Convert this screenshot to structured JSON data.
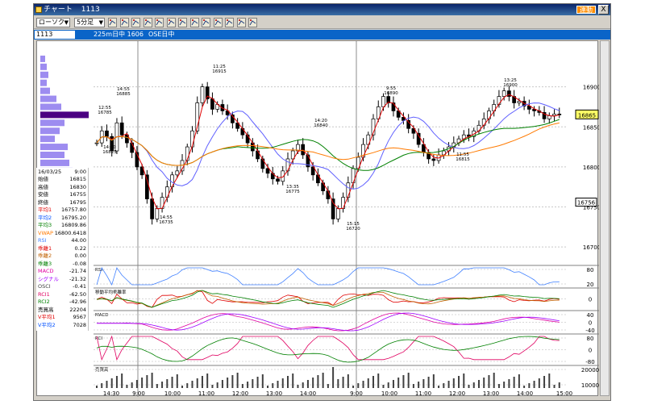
{
  "window": {
    "title": "チャート",
    "symbol": "1113",
    "link_label": "連動",
    "close_label": "X"
  },
  "toolbar": {
    "chart_type": "ローソク",
    "interval": "5分足",
    "tools": [
      "line-tool",
      "trend-tool",
      "hline-tool",
      "vline-tool",
      "fib-tool",
      "zoom-tool",
      "bar-tool",
      "print-tool",
      "draw-tool",
      "copy-tool",
      "paste-tool",
      "settings-tool",
      "delete-tool"
    ]
  },
  "infobar": {
    "symbol": "1113",
    "session": "225m日中 1606",
    "exchange": "OSE日中"
  },
  "price_axis": {
    "ticks": [
      "16900",
      "16850",
      "16800",
      "16750",
      "16700"
    ],
    "last_price": "16865",
    "marker_price": "16756"
  },
  "indicator_axes": {
    "rsi": [
      "80",
      "20"
    ],
    "dev": [
      "0"
    ],
    "macd": [
      "40",
      "0",
      "-40"
    ],
    "rci": [
      "80",
      "0",
      "-80"
    ],
    "volume": [
      "20000",
      "10000"
    ]
  },
  "time_axis": [
    "14:30",
    "9:00",
    "10:00",
    "11:00",
    "12:00",
    "13:00",
    "14:00",
    "9:00",
    "10:00",
    "11:00",
    "12:00",
    "13:00",
    "14:00",
    "15:00"
  ],
  "annotations": [
    {
      "time": "14:55",
      "price": "16885"
    },
    {
      "time": "11:25",
      "price": "16915"
    },
    {
      "time": "14:30",
      "price": "16825"
    },
    {
      "time": "12:55",
      "price": "16785"
    },
    {
      "time": "14:55",
      "price": "16735"
    },
    {
      "time": "14:20",
      "price": "16840"
    },
    {
      "time": "13:35",
      "price": "16775"
    },
    {
      "time": "15:15",
      "price": "16720"
    },
    {
      "time": "9:55",
      "price": "16890"
    },
    {
      "time": "13:25",
      "price": "16900"
    },
    {
      "time": "11:55",
      "price": "16815"
    }
  ],
  "panel_labels": {
    "rsi": "RSI",
    "dev": "移動平均乖離率",
    "macd": "MACD",
    "rci": "RCI",
    "volume": "売買高"
  },
  "info_panel": {
    "date": "16/03/25",
    "time": "9:00",
    "rows": [
      {
        "label": "始値",
        "value": "16815",
        "color": "#000000"
      },
      {
        "label": "高値",
        "value": "16830",
        "color": "#000000"
      },
      {
        "label": "安値",
        "value": "16755",
        "color": "#000000"
      },
      {
        "label": "終値",
        "value": "16795",
        "color": "#000000"
      },
      {
        "label": "平均1",
        "value": "16757.80",
        "color": "#e00000"
      },
      {
        "label": "平均2",
        "value": "16795.20",
        "color": "#0050ff"
      },
      {
        "label": "平均3",
        "value": "16809.86",
        "color": "#008000"
      },
      {
        "label": "VWAP",
        "value": "16800.6418",
        "color": "#ff7a00"
      },
      {
        "label": "RSI",
        "value": "44.00",
        "color": "#4080ff"
      },
      {
        "label": "乖離1",
        "value": "0.22",
        "color": "#e00000"
      },
      {
        "label": "乖離2",
        "value": "0.00",
        "color": "#c06000"
      },
      {
        "label": "乖離3",
        "value": "-0.08",
        "color": "#008000"
      },
      {
        "label": "MACD",
        "value": "-21.74",
        "color": "#e000a0"
      },
      {
        "label": "シグナル",
        "value": "-21.32",
        "color": "#a000ff"
      },
      {
        "label": "OSCI",
        "value": "-0.41",
        "color": "#404040"
      },
      {
        "label": "RCI1",
        "value": "-62.50",
        "color": "#e00060"
      },
      {
        "label": "RCI2",
        "value": "-42.96",
        "color": "#008000"
      },
      {
        "label": "売買高",
        "value": "22204",
        "color": "#000000"
      },
      {
        "label": "V平均1",
        "value": "9567",
        "color": "#e00000"
      },
      {
        "label": "V平均2",
        "value": "7028",
        "color": "#0050ff"
      }
    ]
  },
  "chart_data": {
    "type": "candlestick",
    "price_range": [
      16685,
      16945
    ],
    "closes": [
      16830,
      16845,
      16838,
      16820,
      16855,
      16840,
      16830,
      16818,
      16800,
      16790,
      16760,
      16735,
      16748,
      16762,
      16775,
      16790,
      16795,
      16808,
      16825,
      16845,
      16880,
      16900,
      16885,
      16872,
      16878,
      16870,
      16865,
      16855,
      16848,
      16840,
      16830,
      16820,
      16810,
      16798,
      16792,
      16785,
      16782,
      16795,
      16810,
      16820,
      16828,
      16815,
      16800,
      16790,
      16780,
      16770,
      16760,
      16735,
      16748,
      16762,
      16780,
      16798,
      16812,
      16828,
      16840,
      16860,
      16875,
      16888,
      16880,
      16870,
      16862,
      16858,
      16848,
      16842,
      16828,
      16818,
      16810,
      16808,
      16815,
      16820,
      16825,
      16830,
      16835,
      16840,
      16838,
      16845,
      16852,
      16860,
      16870,
      16878,
      16888,
      16895,
      16888,
      16880,
      16882,
      16876,
      16872,
      16870,
      16868,
      16860,
      16864,
      16866,
      16865
    ],
    "volume_range": [
      0,
      22000
    ]
  }
}
